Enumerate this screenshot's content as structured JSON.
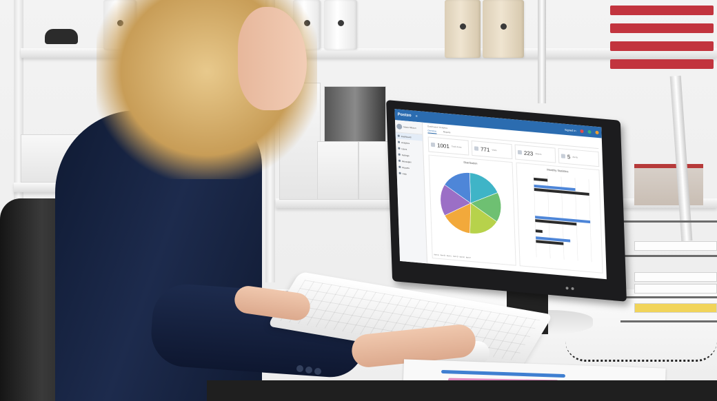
{
  "scene": {
    "description_tags": [
      "office",
      "woman",
      "desk",
      "monitor",
      "keyboard"
    ]
  },
  "dashboard": {
    "brand": "Posteo",
    "user_text": "Signed in",
    "profile_name": "Marta Nilsson",
    "breadcrumb": "Dashboard / Analytics",
    "tabs": [
      "Overview",
      "Reports"
    ],
    "nav_items": [
      "Dashboard",
      "Analytics",
      "Users",
      "Settings",
      "Messages",
      "Reports",
      "Help"
    ],
    "stats": [
      {
        "value": "1001",
        "label": "Total views"
      },
      {
        "value": "771",
        "label": "Visits"
      },
      {
        "value": "223",
        "label": "Orders"
      },
      {
        "value": "5",
        "label": "Alerts"
      }
    ],
    "pie_title": "Distribution",
    "bar_title": "Monthly Statistics",
    "pie_legend": [
      "Item A",
      "Item B",
      "Item C",
      "Item D",
      "Item E",
      "Item F"
    ],
    "status_colors": [
      "#e04b4b",
      "#3cb371",
      "#2b6cb0",
      "#f0a030"
    ]
  },
  "chart_data": [
    {
      "type": "pie",
      "title": "",
      "categories": [
        "A",
        "B",
        "C",
        "D",
        "E",
        "F"
      ],
      "values": [
        18,
        16,
        17,
        16,
        17,
        16
      ],
      "colors": [
        "#3fb4c7",
        "#6ec072",
        "#b7d24b",
        "#f2a93b",
        "#9b6fc6",
        "#4e86d8"
      ]
    },
    {
      "type": "bar",
      "title": "",
      "categories": [
        "1",
        "2",
        "3",
        "4",
        "5",
        "6",
        "7",
        "8"
      ],
      "series": [
        {
          "values": [
            0,
            6,
            0,
            0,
            8,
            0,
            5,
            0
          ],
          "color": "#4e86d8"
        },
        {
          "values": [
            2,
            8,
            0,
            0,
            6,
            1,
            4,
            0
          ],
          "color": "#2b2b2b"
        }
      ]
    }
  ]
}
